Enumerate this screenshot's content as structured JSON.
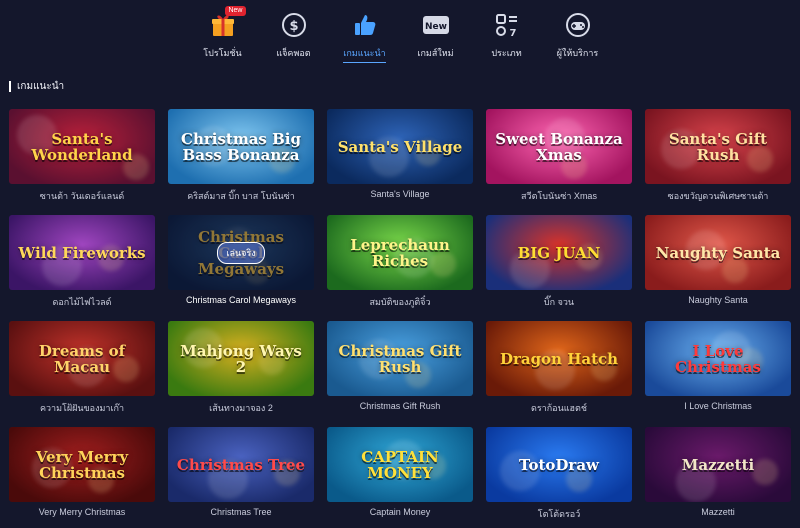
{
  "nav": {
    "items": [
      {
        "label": "โปรโมชั่น",
        "badge": "New",
        "icon": "gift-icon"
      },
      {
        "label": "แจ็คพอต",
        "icon": "dollar-coin-icon"
      },
      {
        "label": "เกมแนะนำ",
        "icon": "thumbs-up-icon",
        "active": true
      },
      {
        "label": "เกมส์ใหม่",
        "badge_box": "New",
        "icon": "new-box-icon"
      },
      {
        "label": "ประเภท",
        "icon": "grid-categories-icon"
      },
      {
        "label": "ผู้ให้บริการ",
        "icon": "gamepad-provider-icon"
      }
    ]
  },
  "section": {
    "title": "เกมแนะนำ"
  },
  "games": [
    {
      "title": "ซานต้า วันเดอร์แลนด์",
      "logo": "Santa's Wonderland",
      "bg": [
        "#5a1030",
        "#b8203a"
      ],
      "fg": "#ffd34a"
    },
    {
      "title": "คริสต์มาส บิ๊ก บาส โบนันซ่า",
      "logo": "Christmas Big Bass Bonanza",
      "bg": [
        "#1e6fb0",
        "#7fc6f0"
      ],
      "fg": "#ffffff"
    },
    {
      "title": "Santa's Village",
      "logo": "Santa's Village",
      "bg": [
        "#0b2a5e",
        "#2e64b8"
      ],
      "fg": "#ffe16a"
    },
    {
      "title": "สวีตโบนันซ่า Xmas",
      "logo": "Sweet Bonanza Xmas",
      "bg": [
        "#a3145f",
        "#ff66b2"
      ],
      "fg": "#ffffff"
    },
    {
      "title": "ซองขวัญดวนพิเศษซานต้า",
      "logo": "Santa's Gift Rush",
      "bg": [
        "#7a1420",
        "#d7434b"
      ],
      "fg": "#ffe0a0"
    },
    {
      "title": "ดอกไม้ไฟไวลด์",
      "logo": "Wild Fireworks",
      "bg": [
        "#3b1566",
        "#a046c0"
      ],
      "fg": "#ffd85a"
    },
    {
      "title": "Christmas Carol Megaways",
      "logo": "Christmas Carol Megaways",
      "bg": [
        "#0c2348",
        "#2a5a8a"
      ],
      "fg": "#ffcf4a",
      "hover": true,
      "play_label": "เล่นจริง"
    },
    {
      "title": "สมบัติของภูติจิ๋ว",
      "logo": "Leprechaun Riches",
      "bg": [
        "#1c6a1e",
        "#7ad84a"
      ],
      "fg": "#fff48a"
    },
    {
      "title": "บิ๊ก จวน",
      "logo": "BIG JUAN",
      "bg": [
        "#1a2f7a",
        "#d8332a"
      ],
      "fg": "#ffdd33"
    },
    {
      "title": "Naughty Santa",
      "logo": "Naughty Santa",
      "bg": [
        "#8a1c1c",
        "#e2584a"
      ],
      "fg": "#ffe6a8"
    },
    {
      "title": "ความโฝ้ฝันของมาเก๊า",
      "logo": "Dreams of Macau",
      "bg": [
        "#5a1010",
        "#c0322a"
      ],
      "fg": "#ffd36a"
    },
    {
      "title": "เส้นทางมาจอง 2",
      "logo": "Mahjong Ways 2",
      "bg": [
        "#3a7a10",
        "#d8b020"
      ],
      "fg": "#fff6b0"
    },
    {
      "title": "Christmas Gift Rush",
      "logo": "Christmas Gift Rush",
      "bg": [
        "#1a5a90",
        "#4aa0e0"
      ],
      "fg": "#ffe070"
    },
    {
      "title": "ดราก้อนแฮตช์",
      "logo": "Dragon Hatch",
      "bg": [
        "#6a1a08",
        "#e0661a"
      ],
      "fg": "#ffd23a"
    },
    {
      "title": "I Love Christmas",
      "logo": "I Love Christmas",
      "bg": [
        "#1a4a9a",
        "#6ab0f0"
      ],
      "fg": "#ff3a3a"
    },
    {
      "title": "Very Merry Christmas",
      "logo": "Very Merry Christmas",
      "bg": [
        "#4a0a0a",
        "#a01e1e"
      ],
      "fg": "#ffd35a"
    },
    {
      "title": "Christmas Tree",
      "logo": "Christmas Tree",
      "bg": [
        "#1a2a6a",
        "#4a62c0"
      ],
      "fg": "#ff4a4a"
    },
    {
      "title": "Captain Money",
      "logo": "CAPTAIN MONEY",
      "bg": [
        "#0a5a8a",
        "#30a8d8"
      ],
      "fg": "#ffe03a"
    },
    {
      "title": "โตโต้ดรอว์",
      "logo": "TotoDraw",
      "bg": [
        "#0a3aa0",
        "#2a7af0"
      ],
      "fg": "#ffffff"
    },
    {
      "title": "Mazzetti",
      "logo": "Mazzetti",
      "bg": [
        "#2a0a3a",
        "#6a1a6a"
      ],
      "fg": "#f2e6c8"
    }
  ]
}
